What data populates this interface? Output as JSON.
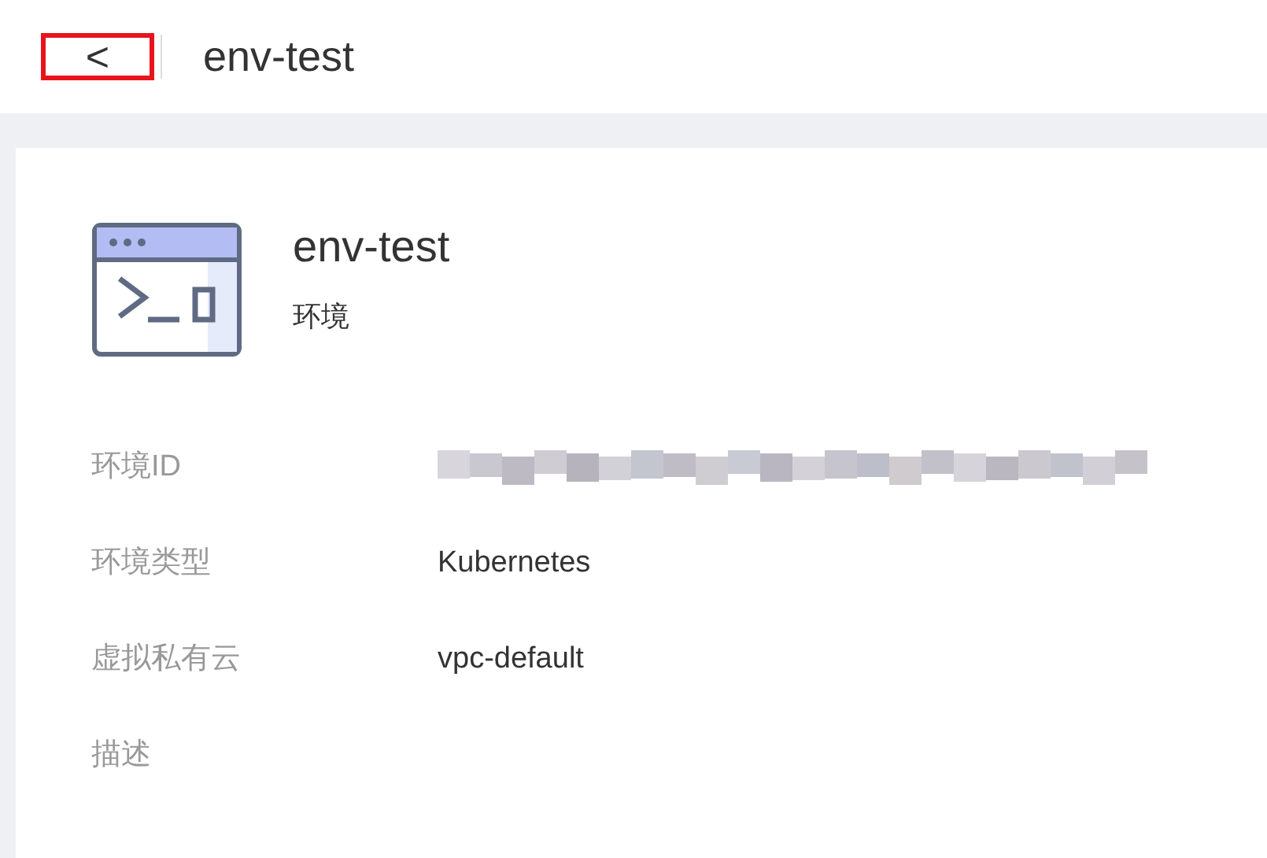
{
  "header": {
    "back_button": {
      "label": "<",
      "highlighted": true
    },
    "title": "env-test"
  },
  "card": {
    "name": "env-test",
    "type": "环境",
    "fields": [
      {
        "label": "环境ID",
        "kind": "redacted"
      },
      {
        "label": "环境类型",
        "kind": "text",
        "value": "Kubernetes"
      },
      {
        "label": "虚拟私有云",
        "kind": "text",
        "value": "vpc-default"
      },
      {
        "label": "描述",
        "kind": "text"
      }
    ]
  }
}
